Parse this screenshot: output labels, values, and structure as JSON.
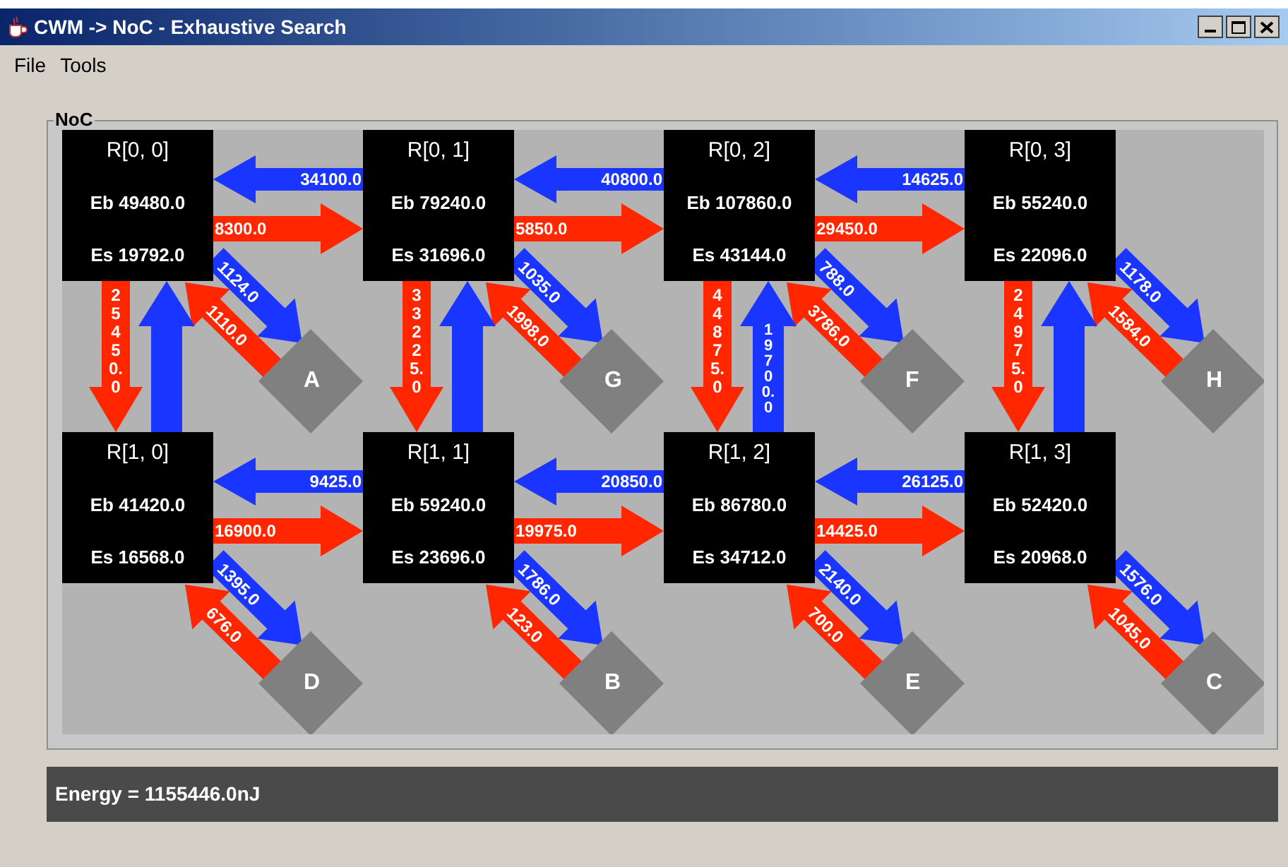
{
  "window": {
    "title": "CWM -> NoC - Exhaustive Search"
  },
  "menu": [
    {
      "label": "File"
    },
    {
      "label": "Tools"
    }
  ],
  "noc": {
    "title": "NoC",
    "rows": [
      {
        "routers": [
          {
            "name": "R[0, 0]",
            "eb": "Eb 49480.0",
            "es": "Es 19792.0",
            "core": {
              "label": "A",
              "to_core": "1124.0",
              "from_core": "1110.0"
            }
          },
          {
            "name": "R[0, 1]",
            "eb": "Eb 79240.0",
            "es": "Es 31696.0",
            "core": {
              "label": "G",
              "to_core": "1035.0",
              "from_core": "1998.0"
            }
          },
          {
            "name": "R[0, 2]",
            "eb": "Eb 107860.0",
            "es": "Es 43144.0",
            "core": {
              "label": "F",
              "to_core": "788.0",
              "from_core": "3786.0"
            }
          },
          {
            "name": "R[0, 3]",
            "eb": "Eb 55240.0",
            "es": "Es 22096.0",
            "core": {
              "label": "H",
              "to_core": "1178.0",
              "from_core": "1584.0"
            }
          }
        ],
        "east_links": [
          {
            "westward": "34100.0",
            "eastward": "8300.0"
          },
          {
            "westward": "40800.0",
            "eastward": "5850.0"
          },
          {
            "westward": "14625.0",
            "eastward": "29450.0"
          }
        ]
      },
      {
        "routers": [
          {
            "name": "R[1, 0]",
            "eb": "Eb 41420.0",
            "es": "Es 16568.0",
            "core": {
              "label": "D",
              "to_core": "1395.0",
              "from_core": "676.0"
            }
          },
          {
            "name": "R[1, 1]",
            "eb": "Eb 59240.0",
            "es": "Es 23696.0",
            "core": {
              "label": "B",
              "to_core": "1786.0",
              "from_core": "123.0"
            }
          },
          {
            "name": "R[1, 2]",
            "eb": "Eb 86780.0",
            "es": "Es 34712.0",
            "core": {
              "label": "E",
              "to_core": "2140.0",
              "from_core": "700.0"
            }
          },
          {
            "name": "R[1, 3]",
            "eb": "Eb 52420.0",
            "es": "Es 20968.0",
            "core": {
              "label": "C",
              "to_core": "1576.0",
              "from_core": "1045.0"
            }
          }
        ],
        "east_links": [
          {
            "westward": "9425.0",
            "eastward": "16900.0"
          },
          {
            "westward": "20850.0",
            "eastward": "19975.0"
          },
          {
            "westward": "26125.0",
            "eastward": "14425.0"
          }
        ]
      }
    ],
    "vertical_links": [
      {
        "down": "25450.0"
      },
      {
        "down": "33225.0"
      },
      {
        "down": "44875.0",
        "up": "19700.0"
      },
      {
        "down": "24975.0"
      }
    ]
  },
  "energy": "Energy = 1155446.0nJ"
}
